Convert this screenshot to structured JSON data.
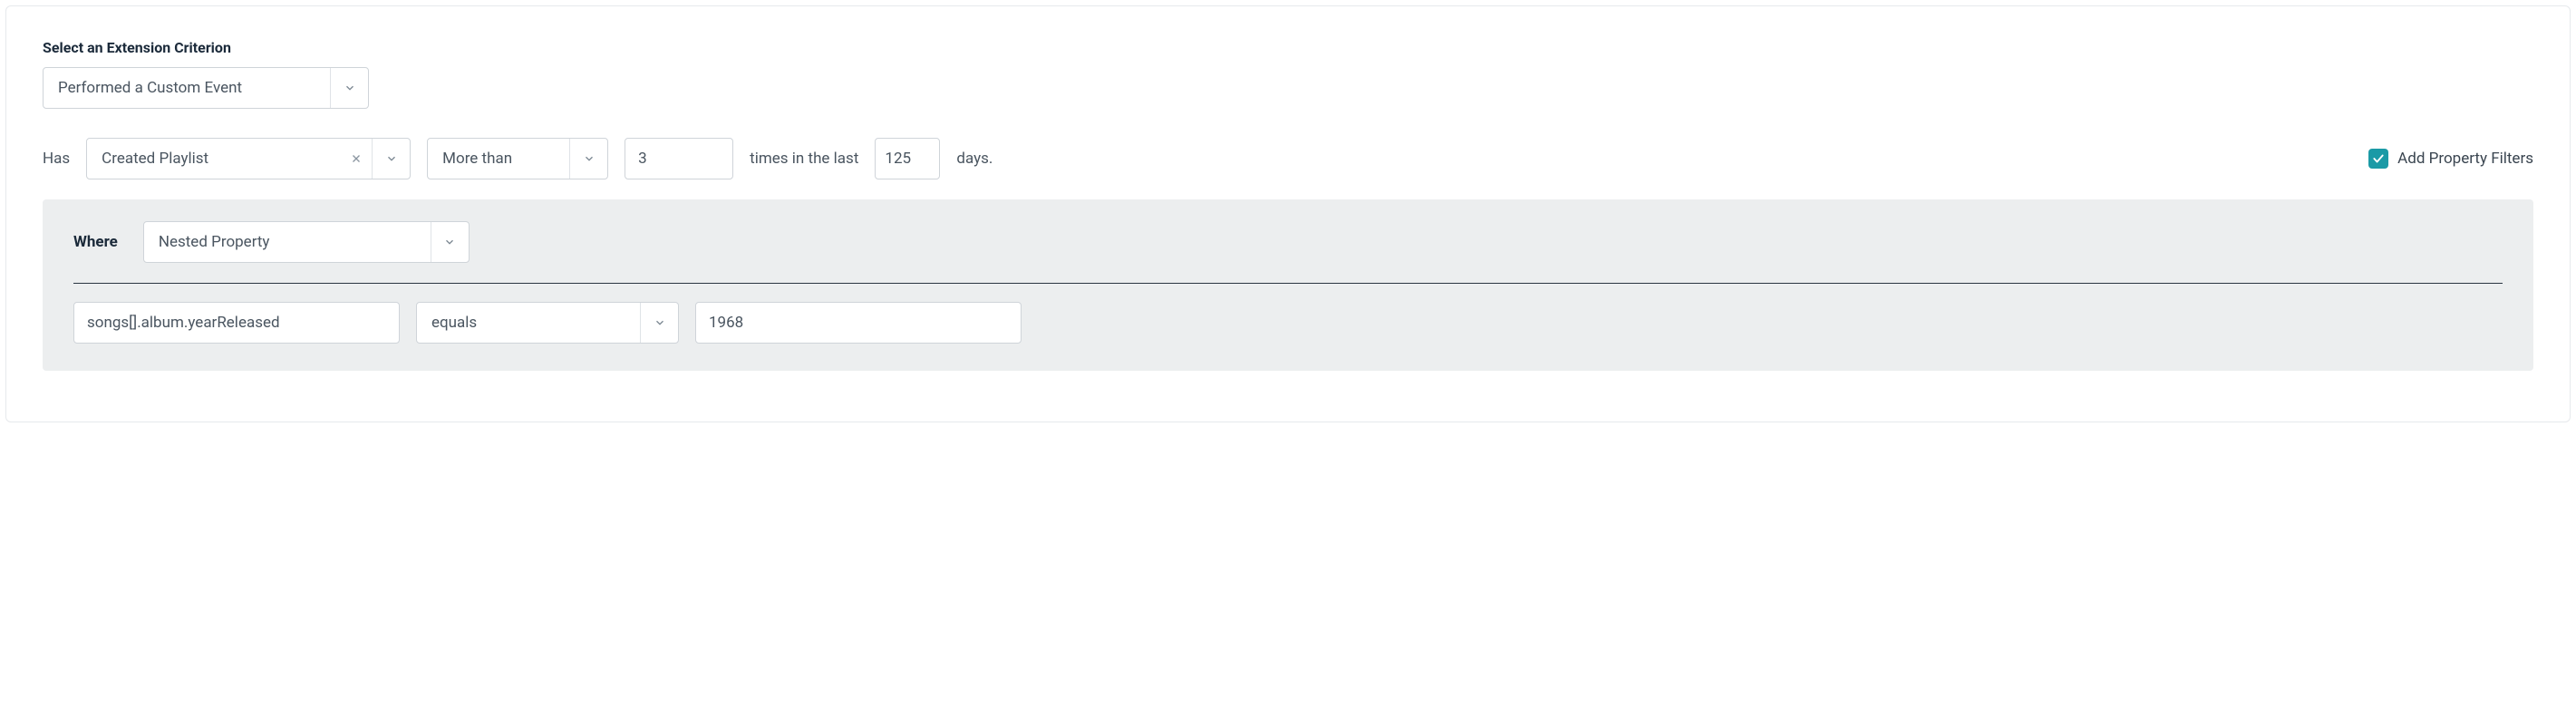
{
  "criterion": {
    "label": "Select an Extension Criterion",
    "value": "Performed a Custom Event"
  },
  "has": {
    "prefix": "Has",
    "event": "Created Playlist",
    "comparator": "More than",
    "count": "3",
    "middle_text": "times in the last",
    "days": "125",
    "suffix": "days."
  },
  "property_filters_toggle": {
    "checked": true,
    "label": "Add Property Filters"
  },
  "where": {
    "label": "Where",
    "type": "Nested Property",
    "property_path": "songs[].album.yearReleased",
    "operator": "equals",
    "value": "1968"
  }
}
